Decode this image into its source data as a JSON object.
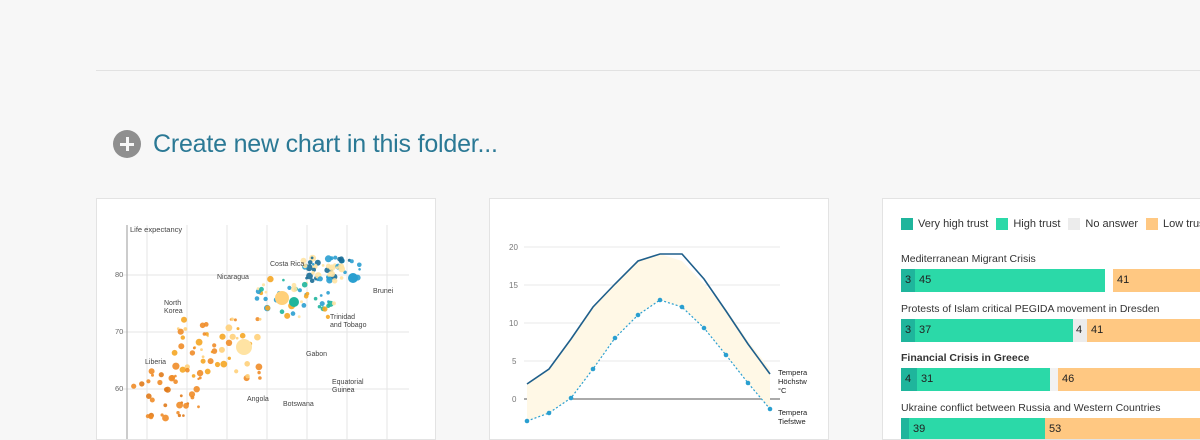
{
  "create_label": "Create new chart in this folder...",
  "colors": {
    "accent_text": "#2b7995",
    "very_high": "#1fb59c",
    "high": "#2bd9a8",
    "no_answer": "#ececec",
    "low": "#ffc882",
    "very_low": "#f08c28"
  },
  "cards": {
    "scatter": {
      "ylabel": "Life expectancy",
      "yticks": [
        "80",
        "70",
        "60"
      ],
      "labels": {
        "costa_rica": "Costa Rica",
        "nicaragua": "Nicaragua",
        "brunei": "Brunei",
        "north_korea_1": "North",
        "north_korea_2": "Korea",
        "trinidad_1": "Trinidad",
        "trinidad_2": "and Tobago",
        "liberia": "Liberia",
        "gabon": "Gabon",
        "eq_guinea_1": "Equatorial",
        "eq_guinea_2": "Guinea",
        "angola": "Angola",
        "botswana": "Botswana"
      }
    },
    "temperature": {
      "yticks": [
        "20",
        "15",
        "10",
        "5",
        "0"
      ],
      "high_label_1": "Tempera",
      "high_label_2": "Höchstw",
      "high_label_3": "°C",
      "low_label_1": "Tempera",
      "low_label_2": "Tiefstwe"
    },
    "trust": {
      "legend": [
        "Very high trust",
        "High trust",
        "No answer",
        "Low trust"
      ],
      "rows": [
        {
          "title": "Mediterranean Migrant Crisis",
          "bold": false,
          "very_high": "3",
          "high": "45",
          "no_answer": "",
          "low": "41"
        },
        {
          "title": "Protests of Islam critical PEGIDA movement in Dresden",
          "bold": false,
          "very_high": "3",
          "high": "37",
          "no_answer": "4",
          "low": "41"
        },
        {
          "title": "Financial Crisis in Greece",
          "bold": true,
          "very_high": "4",
          "high": "31",
          "no_answer": "",
          "low": "46"
        },
        {
          "title": "Ukraine conflict between Russia and Western Countries",
          "bold": false,
          "very_high": "",
          "high": "39",
          "no_answer": "",
          "low": "53"
        }
      ]
    }
  }
}
